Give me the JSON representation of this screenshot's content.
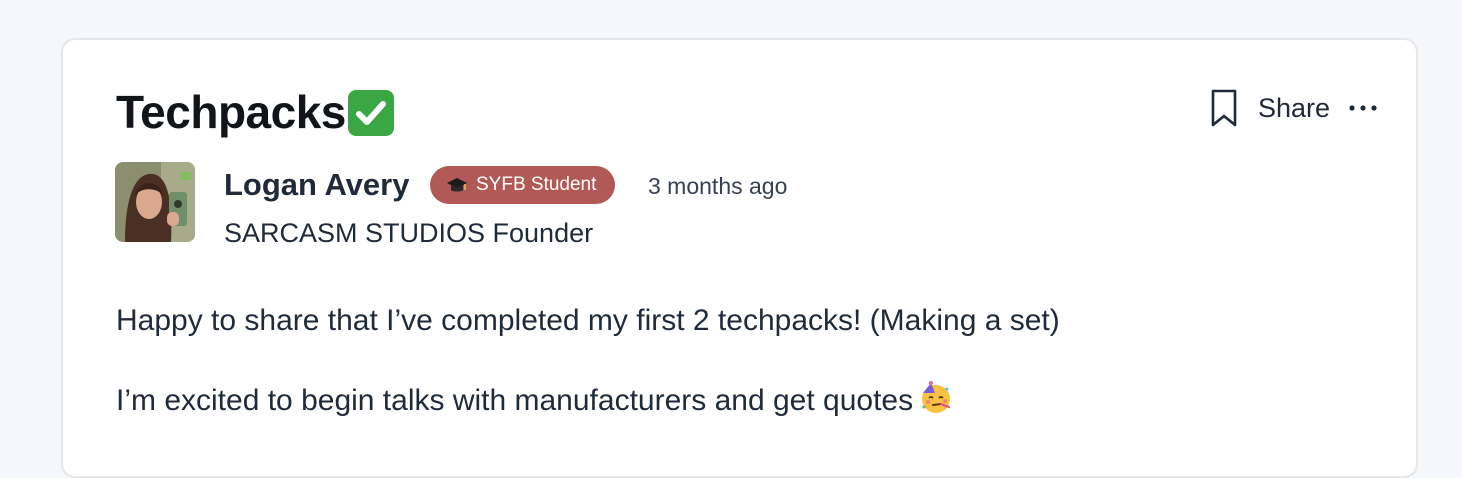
{
  "post": {
    "title": "Techpacks",
    "title_emoji": "check-mark-button-icon",
    "actions": {
      "share_label": "Share"
    },
    "author": {
      "name": "Logan Avery",
      "badge": "SYFB Student",
      "badge_icon": "graduation-cap-icon",
      "timestamp": "3 months ago",
      "title": "SARCASM STUDIOS Founder"
    },
    "body": {
      "paragraph_1": "Happy to share that I’ve completed my first 2 techpacks! (Making a set)",
      "paragraph_2": "I’m excited to begin talks with manufacturers and get quotes",
      "paragraph_2_emoji": "partying-face-icon"
    }
  },
  "colors": {
    "badge_bg": "#b15a55",
    "check_green": "#3aa744",
    "card_border": "#e5e7eb",
    "page_bg": "#f6f7f9"
  }
}
